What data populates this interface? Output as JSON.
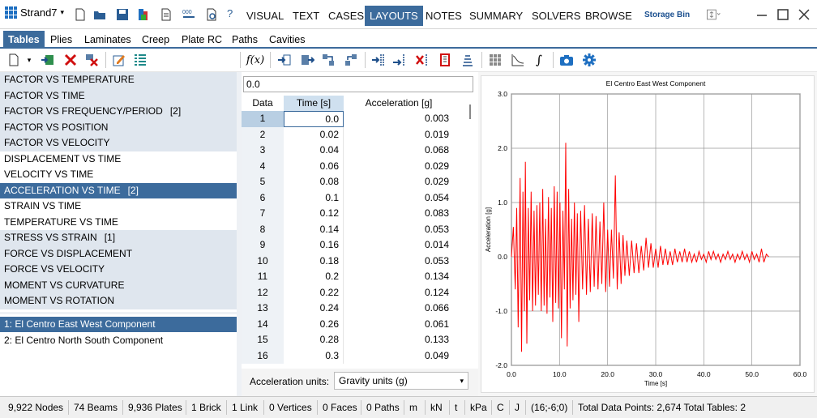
{
  "app": {
    "title": "Strand7"
  },
  "menu_tabs": [
    {
      "label": "VISUAL"
    },
    {
      "label": "TEXT"
    },
    {
      "label": "CASES"
    },
    {
      "label": "LAYOUTS"
    },
    {
      "label": "NOTES"
    },
    {
      "label": "SUMMARY"
    },
    {
      "label": "SOLVERS"
    },
    {
      "label": "BROWSE"
    }
  ],
  "active_menu_tab": "LAYOUTS",
  "storage_bin": "Storage Bin",
  "toolbar_help": "?",
  "sub_tabs": [
    {
      "label": "Tables"
    },
    {
      "label": "Plies"
    },
    {
      "label": "Laminates"
    },
    {
      "label": "Creep"
    },
    {
      "label": "Plate RC"
    },
    {
      "label": "Paths"
    },
    {
      "label": "Cavities"
    }
  ],
  "active_sub_tab": "Tables",
  "fx_label": "f(x)",
  "integral_label": "∫",
  "table_types": [
    {
      "label": "FACTOR VS TEMPERATURE",
      "count": ""
    },
    {
      "label": "FACTOR VS TIME",
      "count": ""
    },
    {
      "label": "FACTOR VS FREQUENCY/PERIOD",
      "count": "[2]"
    },
    {
      "label": "FACTOR VS POSITION",
      "count": ""
    },
    {
      "label": "FACTOR VS VELOCITY",
      "count": ""
    },
    {
      "label": "DISPLACEMENT VS TIME",
      "count": ""
    },
    {
      "label": "VELOCITY VS TIME",
      "count": ""
    },
    {
      "label": "ACCELERATION VS TIME",
      "count": "[2]"
    },
    {
      "label": "STRAIN VS TIME",
      "count": ""
    },
    {
      "label": "TEMPERATURE VS TIME",
      "count": ""
    },
    {
      "label": "STRESS VS STRAIN",
      "count": "[1]"
    },
    {
      "label": "FORCE VS DISPLACEMENT",
      "count": ""
    },
    {
      "label": "FORCE VS VELOCITY",
      "count": ""
    },
    {
      "label": "MOMENT VS CURVATURE",
      "count": ""
    },
    {
      "label": "MOMENT VS ROTATION",
      "count": ""
    }
  ],
  "selected_table_type": "ACCELERATION VS TIME",
  "tables": [
    {
      "label": "1: El Centro East West Component"
    },
    {
      "label": "2: El Centro North South Component"
    }
  ],
  "selected_table": "1: El Centro East West Component",
  "cell_value": "0.0",
  "grid": {
    "headers": [
      "Data",
      "Time [s]",
      "Acceleration [g]"
    ],
    "rows": [
      [
        "1",
        "0.0",
        "0.003"
      ],
      [
        "2",
        "0.02",
        "0.019"
      ],
      [
        "3",
        "0.04",
        "0.068"
      ],
      [
        "4",
        "0.06",
        "0.029"
      ],
      [
        "5",
        "0.08",
        "0.029"
      ],
      [
        "6",
        "0.1",
        "0.054"
      ],
      [
        "7",
        "0.12",
        "0.083"
      ],
      [
        "8",
        "0.14",
        "0.053"
      ],
      [
        "9",
        "0.16",
        "0.014"
      ],
      [
        "10",
        "0.18",
        "0.053"
      ],
      [
        "11",
        "0.2",
        "0.134"
      ],
      [
        "12",
        "0.22",
        "0.124"
      ],
      [
        "13",
        "0.24",
        "0.066"
      ],
      [
        "14",
        "0.26",
        "0.061"
      ],
      [
        "15",
        "0.28",
        "0.133"
      ],
      [
        "16",
        "0.3",
        "0.049"
      ]
    ]
  },
  "units": {
    "label": "Acceleration units:",
    "value": "Gravity units (g)"
  },
  "chart_data": {
    "type": "line",
    "title": "El Centro East West Component",
    "xlabel": "Time [s]",
    "ylabel": "Acceleration [g]",
    "xlim": [
      0,
      60
    ],
    "ylim": [
      -2,
      3
    ],
    "xticks": [
      "0.0",
      "10.0",
      "20.0",
      "30.0",
      "40.0",
      "50.0",
      "60.0"
    ],
    "yticks": [
      "3.0",
      "2.0",
      "1.0",
      "0.0",
      "-1.0",
      "-2.0"
    ],
    "grid": true,
    "color": "#ff0000",
    "series": [
      {
        "x": [
          0.0,
          0.4,
          0.8,
          1.1,
          1.4,
          1.8,
          2.1,
          2.4,
          2.7,
          2.9,
          3.2,
          3.5,
          3.8,
          4.1,
          4.4,
          4.7,
          5.0,
          5.3,
          5.6,
          5.9,
          6.2,
          6.5,
          6.8,
          7.1,
          7.4,
          7.7,
          8.0,
          8.3,
          8.6,
          8.9,
          9.2,
          9.5,
          9.8,
          10.1,
          10.4,
          10.7,
          11.0,
          11.3,
          11.6,
          11.9,
          12.2,
          12.5,
          12.8,
          13.1,
          13.4,
          13.7,
          14.0,
          14.4,
          14.8,
          15.2,
          15.6,
          16.0,
          16.4,
          16.8,
          17.2,
          17.6,
          18.0,
          18.4,
          18.8,
          19.2,
          19.6,
          20.0,
          20.4,
          20.8,
          21.2,
          21.6,
          22.0,
          22.4,
          22.8,
          23.2,
          23.6,
          24.0,
          24.5,
          25.0,
          25.5,
          26.0,
          26.5,
          27.0,
          27.5,
          28.0,
          28.5,
          29.0,
          29.5,
          30.0,
          30.5,
          31.0,
          31.5,
          32.0,
          32.5,
          33.0,
          33.5,
          34.0,
          34.5,
          35.0,
          35.5,
          36.0,
          36.5,
          37.0,
          37.5,
          38.0,
          38.5,
          39.0,
          39.5,
          40.0,
          40.5,
          41.0,
          41.5,
          42.0,
          42.5,
          43.0,
          43.5,
          44.0,
          44.5,
          45.0,
          45.5,
          46.0,
          46.5,
          47.0,
          47.5,
          48.0,
          48.5,
          49.0,
          49.5,
          50.0,
          50.5,
          51.0,
          51.5,
          52.0,
          52.5,
          53.0,
          53.5
        ],
        "y": [
          0.0,
          0.55,
          -0.6,
          0.9,
          -1.3,
          1.45,
          -1.75,
          1.2,
          -1.0,
          1.75,
          -1.6,
          0.9,
          -0.8,
          1.2,
          -1.0,
          0.85,
          -0.9,
          0.95,
          -0.7,
          1.0,
          -1.0,
          1.25,
          -0.9,
          0.7,
          -1.05,
          1.1,
          -0.75,
          0.9,
          -1.2,
          1.3,
          -0.85,
          1.2,
          -0.95,
          1.0,
          -1.5,
          0.85,
          -0.6,
          2.1,
          -1.65,
          1.25,
          -0.95,
          0.7,
          -0.8,
          1.0,
          -0.7,
          0.8,
          -1.2,
          0.85,
          -0.6,
          0.95,
          -0.7,
          0.7,
          -0.65,
          0.8,
          -0.55,
          0.75,
          -0.6,
          0.65,
          -0.5,
          1.0,
          -0.65,
          0.5,
          -0.55,
          0.5,
          -0.4,
          1.5,
          -0.6,
          0.45,
          -0.5,
          0.4,
          -0.35,
          0.3,
          -0.35,
          0.3,
          -0.3,
          0.25,
          -0.3,
          0.2,
          -0.25,
          0.35,
          -0.2,
          0.25,
          -0.2,
          0.15,
          -0.2,
          0.2,
          -0.15,
          0.15,
          -0.15,
          0.1,
          -0.15,
          0.15,
          -0.1,
          0.1,
          -0.1,
          0.15,
          -0.1,
          0.1,
          -0.1,
          0.05,
          -0.1,
          0.1,
          -0.05,
          0.05,
          -0.1,
          0.1,
          -0.05,
          0.1,
          -0.05,
          0.05,
          -0.1,
          0.05,
          -0.05,
          0.1,
          -0.05,
          0.05,
          -0.1,
          0.05,
          -0.05,
          0.1,
          -0.05,
          0.05,
          -0.1,
          0.1,
          -0.05,
          0.05,
          -0.1,
          0.15,
          -0.1,
          0.05,
          0.0
        ]
      }
    ]
  },
  "status": [
    "9,922 Nodes",
    "74 Beams",
    "9,936 Plates",
    "1 Brick",
    "1 Link",
    "0 Vertices",
    "0 Faces",
    "0 Paths",
    "m",
    "kN",
    "t",
    "kPa",
    "C",
    "J",
    "(16;-6;0)",
    "Total Data Points:  2,674  Total Tables: 2"
  ],
  "colors": {
    "accent": "#3c6b9c",
    "list_bg": "#dfe6ee",
    "plot_line": "#ff0000"
  }
}
